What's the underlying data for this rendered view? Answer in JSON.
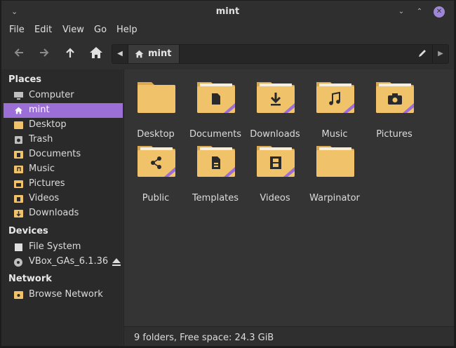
{
  "window": {
    "title": "mint",
    "controls": {
      "menu": "⌄",
      "minimize": "⌄",
      "maximize": "⌃",
      "close": "✕"
    }
  },
  "menubar": [
    "File",
    "Edit",
    "View",
    "Go",
    "Help"
  ],
  "toolbar": {
    "path_crumb": "mint"
  },
  "sidebar": {
    "places_heading": "Places",
    "places": [
      {
        "label": "Computer",
        "icon": "computer-icon"
      },
      {
        "label": "mint",
        "icon": "home-icon",
        "selected": true
      },
      {
        "label": "Desktop",
        "icon": "desktop-folder-icon"
      },
      {
        "label": "Trash",
        "icon": "trash-icon"
      },
      {
        "label": "Documents",
        "icon": "documents-folder-icon"
      },
      {
        "label": "Music",
        "icon": "music-folder-icon"
      },
      {
        "label": "Pictures",
        "icon": "pictures-folder-icon"
      },
      {
        "label": "Videos",
        "icon": "videos-folder-icon"
      },
      {
        "label": "Downloads",
        "icon": "downloads-folder-icon"
      }
    ],
    "devices_heading": "Devices",
    "devices": [
      {
        "label": "File System",
        "icon": "drive-icon"
      },
      {
        "label": "VBox_GAs_6.1.36",
        "icon": "disc-icon"
      }
    ],
    "network_heading": "Network",
    "network": [
      {
        "label": "Browse Network",
        "icon": "network-folder-icon"
      }
    ]
  },
  "folders": [
    {
      "label": "Desktop",
      "icon": "desktop-folder-icon",
      "emblem": ""
    },
    {
      "label": "Documents",
      "icon": "documents-folder-icon",
      "emblem": "document"
    },
    {
      "label": "Downloads",
      "icon": "downloads-folder-icon",
      "emblem": "download"
    },
    {
      "label": "Music",
      "icon": "music-folder-icon",
      "emblem": "music"
    },
    {
      "label": "Pictures",
      "icon": "pictures-folder-icon",
      "emblem": "camera"
    },
    {
      "label": "Public",
      "icon": "public-folder-icon",
      "emblem": "share"
    },
    {
      "label": "Templates",
      "icon": "templates-folder-icon",
      "emblem": "template"
    },
    {
      "label": "Videos",
      "icon": "videos-folder-icon",
      "emblem": "film"
    },
    {
      "label": "Warpinator",
      "icon": "warpinator-folder-icon",
      "emblem": ""
    }
  ],
  "statusbar": {
    "text": "9 folders, Free space: 24.3 GiB"
  },
  "colors": {
    "accent": "#9b6fd6",
    "folder": "#f0c36b",
    "folder_dark": "#d9a84f",
    "emblem": "#2a2a2a",
    "stripe": "#9b6fd6"
  }
}
